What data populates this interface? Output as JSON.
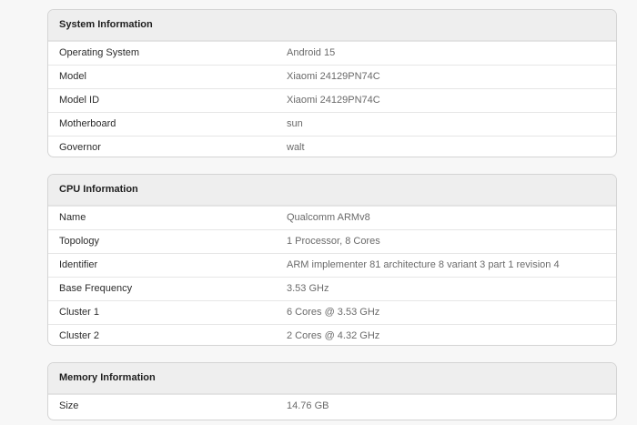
{
  "system": {
    "title": "System Information",
    "rows": [
      {
        "label": "Operating System",
        "value": "Android 15"
      },
      {
        "label": "Model",
        "value": "Xiaomi 24129PN74C"
      },
      {
        "label": "Model ID",
        "value": "Xiaomi 24129PN74C"
      },
      {
        "label": "Motherboard",
        "value": "sun"
      },
      {
        "label": "Governor",
        "value": "walt"
      }
    ]
  },
  "cpu": {
    "title": "CPU Information",
    "rows": [
      {
        "label": "Name",
        "value": "Qualcomm ARMv8"
      },
      {
        "label": "Topology",
        "value": "1 Processor, 8 Cores"
      },
      {
        "label": "Identifier",
        "value": "ARM implementer 81 architecture 8 variant 3 part 1 revision 4"
      },
      {
        "label": "Base Frequency",
        "value": "3.53 GHz"
      },
      {
        "label": "Cluster 1",
        "value": "6 Cores @ 3.53 GHz"
      },
      {
        "label": "Cluster 2",
        "value": "2 Cores @ 4.32 GHz"
      }
    ]
  },
  "memory": {
    "title": "Memory Information",
    "rows": [
      {
        "label": "Size",
        "value": "14.76 GB"
      }
    ]
  }
}
